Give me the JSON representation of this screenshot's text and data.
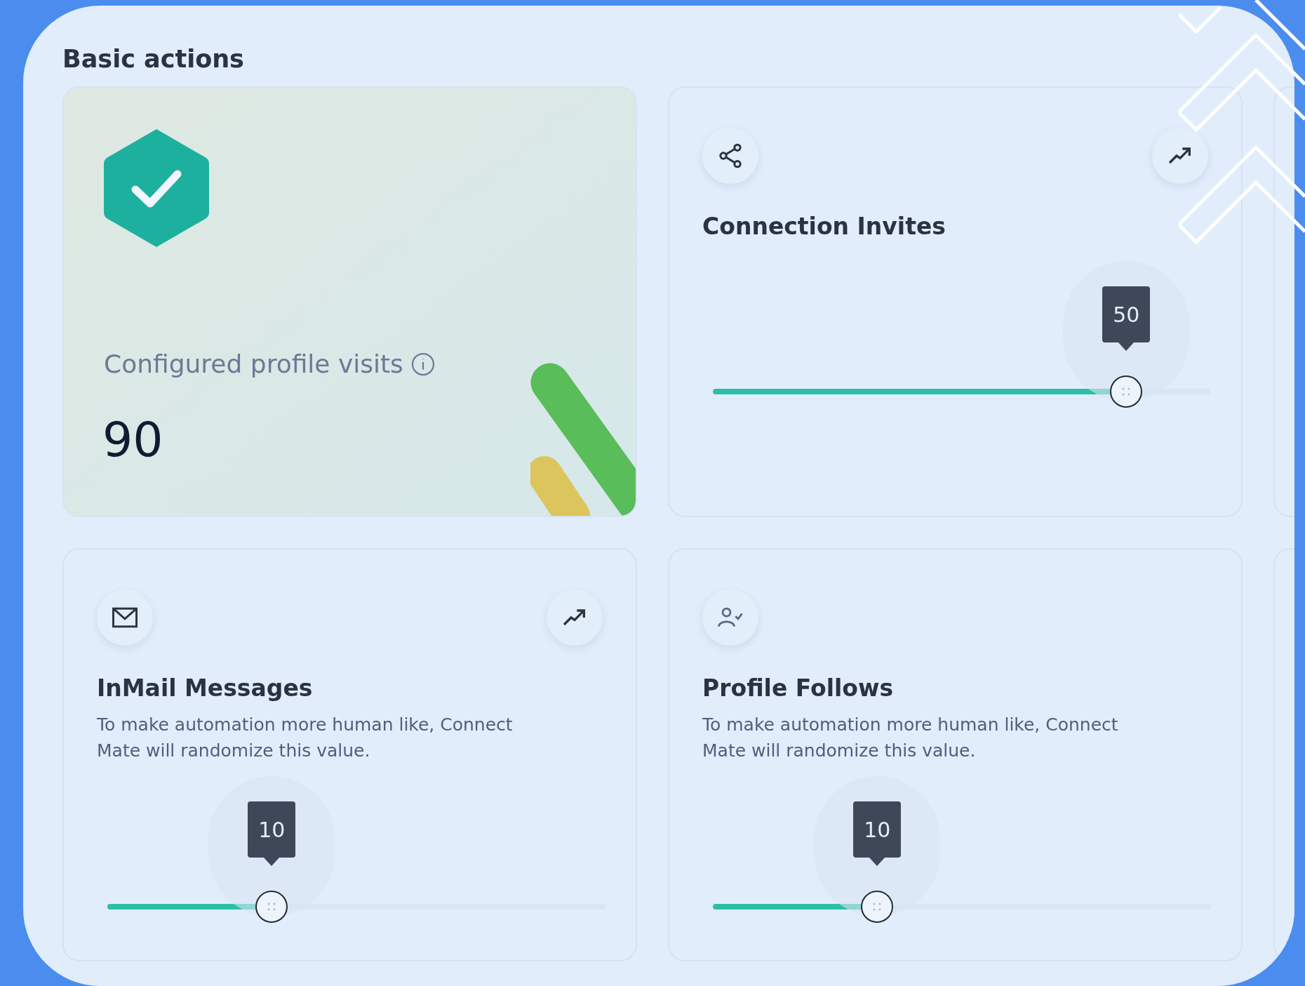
{
  "section": {
    "title": "Basic actions"
  },
  "summary_card": {
    "label": "Configured profile visits",
    "value": "90"
  },
  "cards": [
    {
      "title": "Connection Invites",
      "tooltip": "50",
      "level": 0.83
    },
    {
      "title": "InMail Messages",
      "description": "To make automation more human like, Connect Mate will randomize this value.",
      "tooltip": "10",
      "level": 0.33
    },
    {
      "title": "Profile Follows",
      "description": "To make automation more human like, Connect Mate will randomize this value.",
      "tooltip": "10",
      "level": 0.33
    }
  ]
}
